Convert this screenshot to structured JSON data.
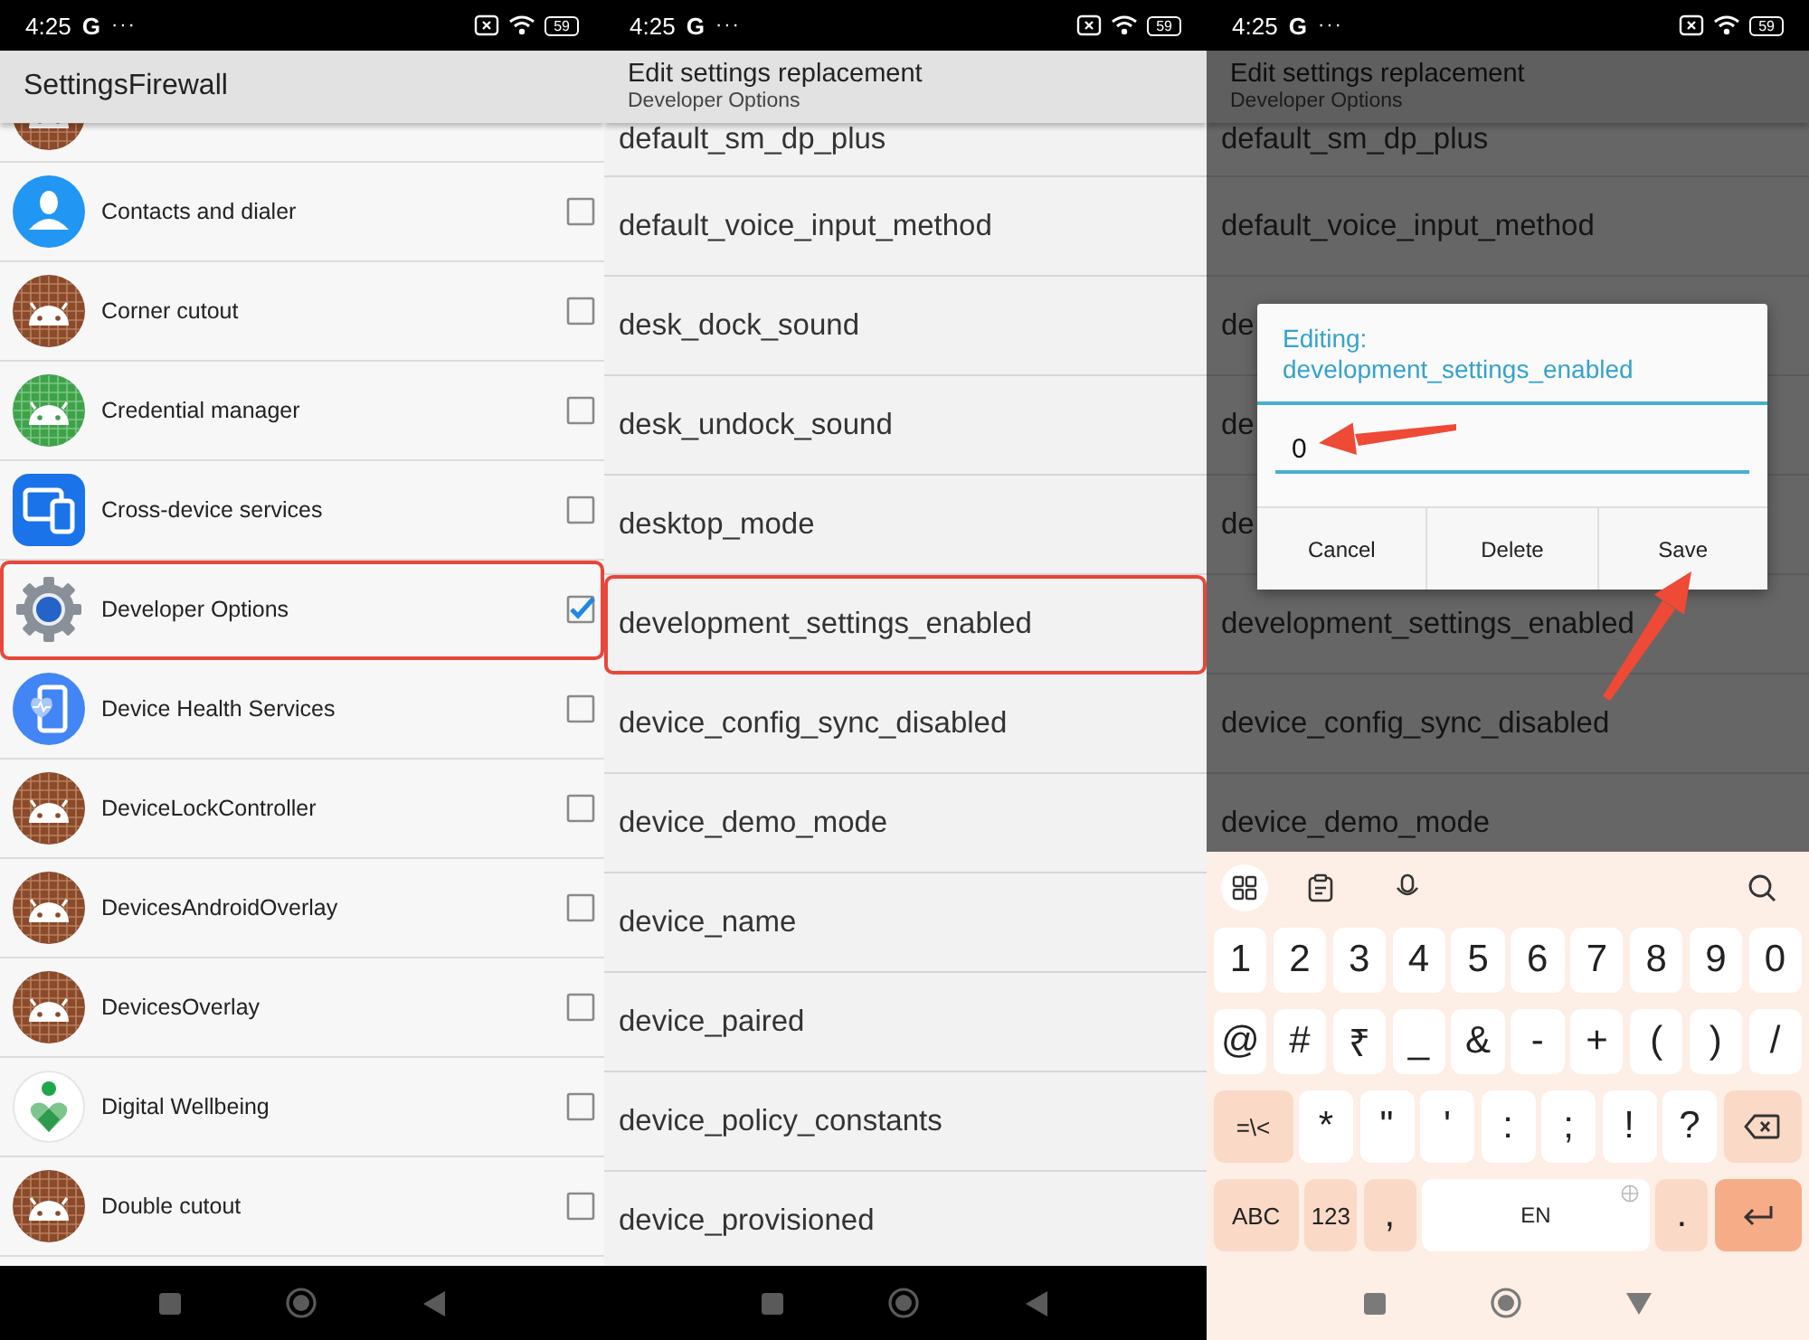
{
  "app_list_screen": {
    "status_bar": {
      "time": "4:25",
      "carrier": "G",
      "more": "···",
      "battery": "59"
    },
    "title": "SettingsFirewall",
    "apps": [
      {
        "kind": "android"
      },
      {
        "kind": "contacts",
        "label": "Contacts and dialer",
        "checked": false,
        "highlighted": false
      },
      {
        "kind": "android",
        "label": "Corner cutout",
        "checked": false,
        "highlighted": false
      },
      {
        "kind": "credential",
        "label": "Credential manager",
        "checked": false,
        "highlighted": false
      },
      {
        "kind": "devices",
        "label": "Cross-device services",
        "checked": false,
        "highlighted": false
      },
      {
        "kind": "gear",
        "label": "Developer Options",
        "checked": true,
        "highlighted": true
      },
      {
        "kind": "health",
        "label": "Device Health Services",
        "checked": false,
        "highlighted": false
      },
      {
        "kind": "android",
        "label": "DeviceLockController",
        "checked": false,
        "highlighted": false
      },
      {
        "kind": "android",
        "label": "DevicesAndroidOverlay",
        "checked": false,
        "highlighted": false
      },
      {
        "kind": "android",
        "label": "DevicesOverlay",
        "checked": false,
        "highlighted": false
      },
      {
        "kind": "wellbeing",
        "label": "Digital Wellbeing",
        "checked": false,
        "highlighted": false
      },
      {
        "kind": "android",
        "label": "Double cutout",
        "checked": false,
        "highlighted": false
      }
    ]
  },
  "settings_screen": {
    "status_bar": {
      "time": "4:25",
      "carrier": "G",
      "more": "···",
      "battery": "59"
    },
    "title": "Edit settings replacement",
    "subtitle": "Developer Options",
    "settings": [
      {
        "name": "default_sm_dp_plus",
        "highlighted": false
      },
      {
        "name": "default_voice_input_method",
        "highlighted": false
      },
      {
        "name": "desk_dock_sound",
        "highlighted": false
      },
      {
        "name": "desk_undock_sound",
        "highlighted": false
      },
      {
        "name": "desktop_mode",
        "highlighted": false
      },
      {
        "name": "development_settings_enabled",
        "highlighted": true
      },
      {
        "name": "device_config_sync_disabled",
        "highlighted": false
      },
      {
        "name": "device_demo_mode",
        "highlighted": false
      },
      {
        "name": "device_name",
        "highlighted": false
      },
      {
        "name": "device_paired",
        "highlighted": false
      },
      {
        "name": "device_policy_constants",
        "highlighted": false
      },
      {
        "name": "device_provisioned",
        "highlighted": false
      }
    ]
  },
  "edit_screen": {
    "status_bar": {
      "time": "4:25",
      "carrier": "G",
      "more": "···",
      "battery": "59"
    },
    "title": "Edit settings replacement",
    "subtitle": "Developer Options",
    "settings": [
      {
        "name": "default_sm_dp_plus",
        "highlighted": false
      },
      {
        "name": "default_voice_input_method",
        "highlighted": false
      },
      {
        "name": "de",
        "highlighted": false
      },
      {
        "name": "de",
        "highlighted": false
      },
      {
        "name": "de",
        "highlighted": false
      },
      {
        "name": "development_settings_enabled",
        "highlighted": false
      },
      {
        "name": "device_config_sync_disabled",
        "highlighted": false
      },
      {
        "name": "device_demo_mode",
        "highlighted": false
      }
    ],
    "dialog": {
      "title": "Editing:",
      "setting": "development_settings_enabled",
      "value": "0",
      "value_arrow": true,
      "buttons": [
        {
          "label": "Cancel",
          "arrow": false
        },
        {
          "label": "Delete",
          "arrow": false
        },
        {
          "label": "Save",
          "arrow": true
        }
      ]
    },
    "keyboard": {
      "rows": [
        {
          "keys": [
            {
              "kind": "key",
              "label": "1"
            },
            {
              "kind": "key",
              "label": "2"
            },
            {
              "kind": "key",
              "label": "3"
            },
            {
              "kind": "key",
              "label": "4"
            },
            {
              "kind": "key",
              "label": "5"
            },
            {
              "kind": "key",
              "label": "6"
            },
            {
              "kind": "key",
              "label": "7"
            },
            {
              "kind": "key",
              "label": "8"
            },
            {
              "kind": "key",
              "label": "9"
            },
            {
              "kind": "key",
              "label": "0"
            }
          ]
        },
        {
          "keys": [
            {
              "kind": "key",
              "label": "@"
            },
            {
              "kind": "key",
              "label": "#"
            },
            {
              "kind": "key",
              "label": "₹"
            },
            {
              "kind": "key",
              "label": "_"
            },
            {
              "kind": "key",
              "label": "&"
            },
            {
              "kind": "key",
              "label": "-"
            },
            {
              "kind": "key",
              "label": "+"
            },
            {
              "kind": "key",
              "label": "("
            },
            {
              "kind": "key",
              "label": ")"
            },
            {
              "kind": "key",
              "label": "/"
            }
          ]
        },
        {
          "keys": [
            {
              "kind": "fn",
              "label": "=\\<"
            },
            {
              "kind": "key",
              "label": "*"
            },
            {
              "kind": "key",
              "label": "\""
            },
            {
              "kind": "key",
              "label": "'"
            },
            {
              "kind": "key",
              "label": ":"
            },
            {
              "kind": "key",
              "label": ";"
            },
            {
              "kind": "key",
              "label": "!"
            },
            {
              "kind": "key",
              "label": "?"
            },
            {
              "kind": "backspace"
            }
          ]
        },
        {
          "keys": [
            {
              "kind": "fn",
              "label": "ABC"
            },
            {
              "kind": "fn",
              "label": "123"
            },
            {
              "kind": "fnchar",
              "label": ","
            },
            {
              "kind": "space",
              "label": "EN"
            },
            {
              "kind": "fnchar",
              "label": "."
            },
            {
              "kind": "enter"
            }
          ]
        }
      ]
    }
  }
}
